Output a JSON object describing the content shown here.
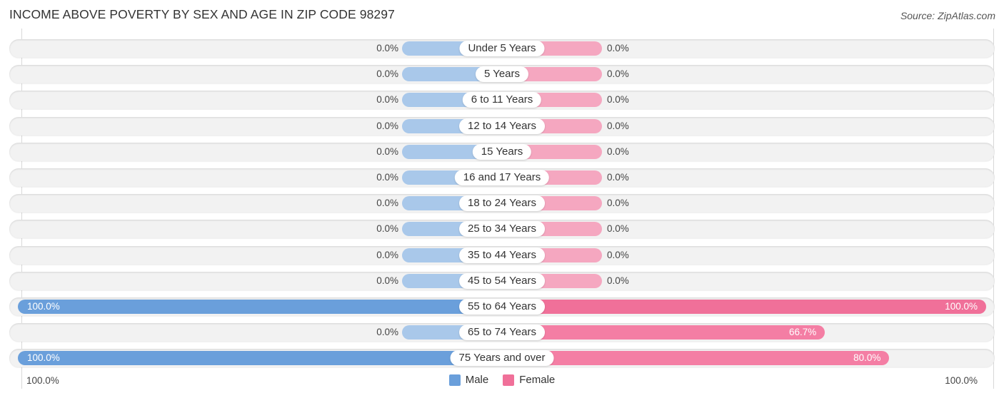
{
  "header": {
    "title": "INCOME ABOVE POVERTY BY SEX AND AGE IN ZIP CODE 98297",
    "source": "Source: ZipAtlas.com"
  },
  "colors": {
    "male": "#6a9fdb",
    "male_light": "#a9c8ea",
    "female": "#f07099",
    "female_light": "#f5a7c0",
    "track": "#f2f2f2"
  },
  "chart_data": {
    "type": "bar",
    "orientation": "horizontal-diverging",
    "title": "INCOME ABOVE POVERTY BY SEX AND AGE IN ZIP CODE 98297",
    "categories": [
      "Under 5 Years",
      "5 Years",
      "6 to 11 Years",
      "12 to 14 Years",
      "15 Years",
      "16 and 17 Years",
      "18 to 24 Years",
      "25 to 34 Years",
      "35 to 44 Years",
      "45 to 54 Years",
      "55 to 64 Years",
      "65 to 74 Years",
      "75 Years and over"
    ],
    "series": [
      {
        "name": "Male",
        "values": [
          0,
          0,
          0,
          0,
          0,
          0,
          0,
          0,
          0,
          0,
          100,
          0,
          100
        ],
        "labels": [
          "0.0%",
          "0.0%",
          "0.0%",
          "0.0%",
          "0.0%",
          "0.0%",
          "0.0%",
          "0.0%",
          "0.0%",
          "0.0%",
          "100.0%",
          "0.0%",
          "100.0%"
        ]
      },
      {
        "name": "Female",
        "values": [
          0,
          0,
          0,
          0,
          0,
          0,
          0,
          0,
          0,
          0,
          100,
          66.7,
          80
        ],
        "labels": [
          "0.0%",
          "0.0%",
          "0.0%",
          "0.0%",
          "0.0%",
          "0.0%",
          "0.0%",
          "0.0%",
          "0.0%",
          "0.0%",
          "100.0%",
          "66.7%",
          "80.0%"
        ]
      }
    ],
    "xlim": [
      -100,
      100
    ],
    "axis_labels": {
      "left": "100.0%",
      "right": "100.0%"
    },
    "legend": {
      "position": "bottom-center",
      "entries": [
        "Male",
        "Female"
      ]
    },
    "grid": false,
    "xlabel": "",
    "ylabel": ""
  }
}
